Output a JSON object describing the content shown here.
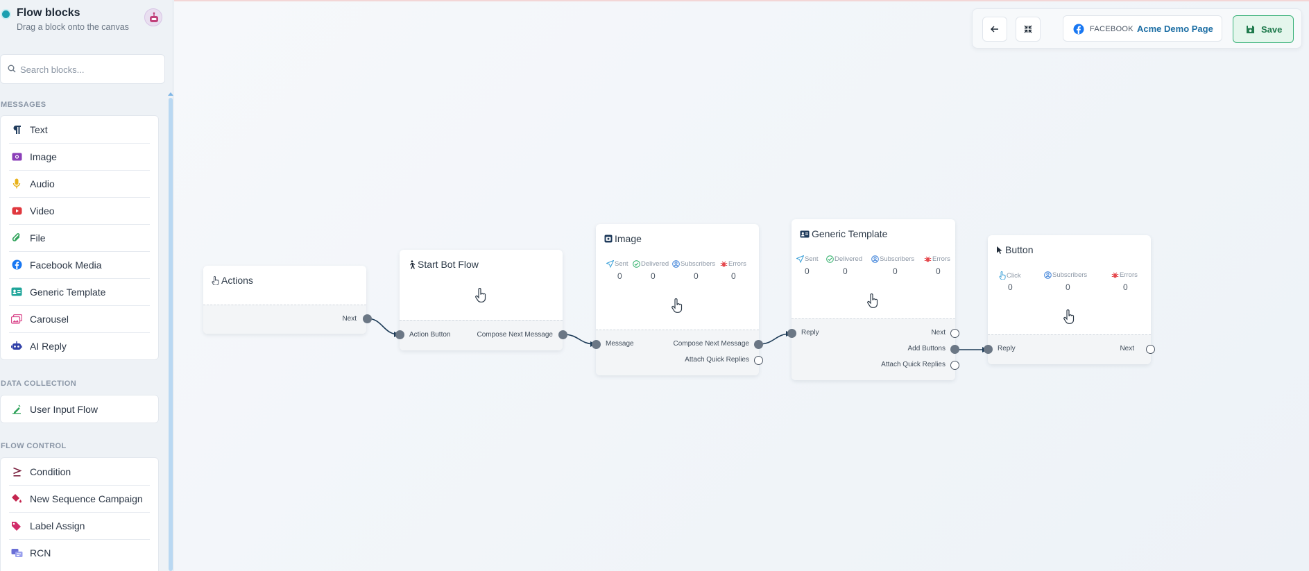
{
  "sidebar": {
    "title": "Flow blocks",
    "subtitle": "Drag a block onto the canvas",
    "search_placeholder": "Search blocks...",
    "sections": [
      {
        "label": "MESSAGES",
        "items": [
          "Text",
          "Image",
          "Audio",
          "Video",
          "File",
          "Facebook Media",
          "Generic Template",
          "Carousel",
          "AI Reply"
        ]
      },
      {
        "label": "DATA COLLECTION",
        "items": [
          "User Input Flow"
        ]
      },
      {
        "label": "FLOW CONTROL",
        "items": [
          "Condition",
          "New Sequence Campaign",
          "Label Assign",
          "RCN"
        ]
      }
    ]
  },
  "topbar": {
    "platform": "FACEBOOK",
    "page_name": "Acme Demo Page",
    "save_label": "Save"
  },
  "nodes": {
    "actions": {
      "title": "Actions",
      "out_label": "Next"
    },
    "start": {
      "title": "Start Bot Flow",
      "in_label": "Action Button",
      "out_label": "Compose Next Message"
    },
    "image": {
      "title": "Image",
      "stats": [
        {
          "label": "Sent",
          "value": "0"
        },
        {
          "label": "Delivered",
          "value": "0"
        },
        {
          "label": "Subscribers",
          "value": "0"
        },
        {
          "label": "Errors",
          "value": "0"
        }
      ],
      "in_label": "Message",
      "out_label": "Compose Next Message",
      "qr_label": "Attach Quick Replies"
    },
    "generic": {
      "title": "Generic Template",
      "stats": [
        {
          "label": "Sent",
          "value": "0"
        },
        {
          "label": "Delivered",
          "value": "0"
        },
        {
          "label": "Subscribers",
          "value": "0"
        },
        {
          "label": "Errors",
          "value": "0"
        }
      ],
      "in_label": "Reply",
      "next_label": "Next",
      "buttons_label": "Add Buttons",
      "qr_label": "Attach Quick Replies"
    },
    "button": {
      "title": "Button",
      "stats": [
        {
          "label": "Click",
          "value": "0"
        },
        {
          "label": "Subscribers",
          "value": "0"
        },
        {
          "label": "Errors",
          "value": "0"
        }
      ],
      "in_label": "Reply",
      "next_label": "Next"
    }
  },
  "colors": {
    "accent": "#1c6ea4",
    "save_green": "#3bb27a",
    "error_red": "#e5484d",
    "sent_blue": "#3aa0d8",
    "delivered_green": "#2fb06a"
  }
}
